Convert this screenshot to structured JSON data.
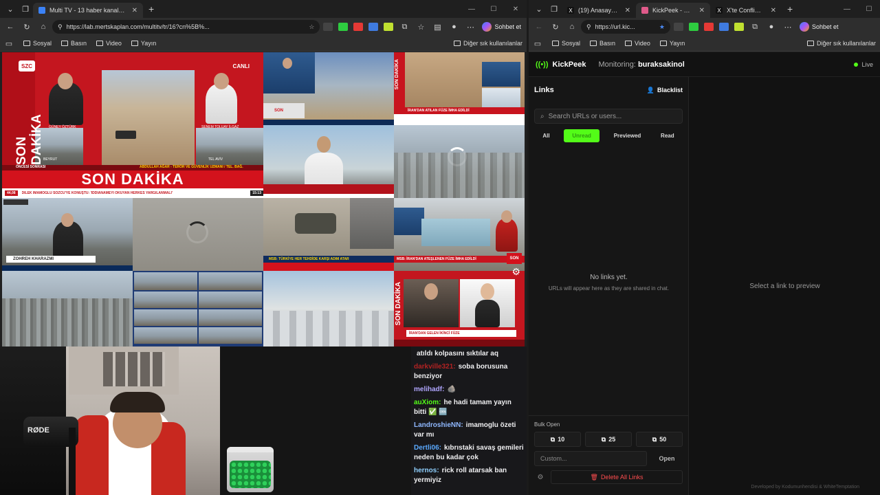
{
  "left_window": {
    "tabs": [
      {
        "title": "Multi TV - 13 haber kanalını aynı a..."
      }
    ],
    "address": "https://lab.mertskaplan.com/multitv/tr/16?cn%5B%...",
    "copilot_label": "Sohbet et",
    "bookmarks": [
      "Sosyal",
      "Basın",
      "Video",
      "Yayın"
    ],
    "other_bookmarks": "Diğer sık kullanılanlar"
  },
  "right_window": {
    "tabs": [
      {
        "title": "(19) Anasayfa / X"
      },
      {
        "title": "KickPeek - Real-tim"
      },
      {
        "title": "X'te Conflict: \"🔴 A"
      }
    ],
    "address": "https://url.kic...",
    "copilot_label": "Sohbet et",
    "bookmarks": [
      "Sosyal",
      "Basın",
      "Video",
      "Yayın"
    ],
    "other_bookmarks": "Diğer sık kullanılanlar"
  },
  "tv": {
    "szc_logo": "SZC",
    "canli": "CANLI",
    "son_dakika_big": "SON DAKİKA",
    "son_dakika_vertical": "SON DAKİKA",
    "ticker_main": "DİLEK İMAMOĞLU SÖZCÜ'YE KONUŞTU: 'İDDİANAMEYİ OKUYAN HERKES YARGILANMALI'",
    "ticker_left": "ÖNCESİ SONRASI",
    "ticker_guest": "ABDULLAH AĞAR - TERÖR VE GÜVENLİK UZMANI / TEL. BAĞ.",
    "temp": "44,08",
    "clock": "15:13",
    "loc_left": "BEYRUT",
    "loc_right": "TEL AVİV",
    "name_left": "GÜNEY ÖZTÜRK",
    "name_right": "SENEM TOLUAY İLGAZ",
    "aj_name": "ZOHREH KHARAZMI",
    "msb1": "MSB: TÜRKİYE HER TEHDİDE KARŞI ADIM ATAR",
    "msb2": "MSB: İRAN'DAN ATEŞLENEN FÜZE İMHA EDİLDİ",
    "iran_top": "İRAN'DAN ATILAN FÜZE İMHA EDİLDİ",
    "iran_bottom": "İRAN'DAN GELEN İKİNCİ FÜZE",
    "son_small": "SON"
  },
  "chat": {
    "messages": [
      {
        "user": "",
        "text": "atıldı kolpasını sıktılar aq",
        "color": "#efeff1"
      },
      {
        "user": "darkville321:",
        "text": "soba borusuna benziyor",
        "color": "#b22222"
      },
      {
        "user": "melihadf:",
        "text": "🪨",
        "color": "#b0a6ff"
      },
      {
        "user": "auXiom:",
        "text": "he hadi tamam yayın bitti ✅ 🆒",
        "color": "#53fc18"
      },
      {
        "user": "LandroshieNN:",
        "text": "imamoglu özeti var mı",
        "color": "#8fb8ff"
      },
      {
        "user": "Dertli06:",
        "text": "kıbrıstaki savaş gemileri neden bu kadar çok",
        "color": "#5aa9ff"
      },
      {
        "user": "hernos:",
        "text": "rick roll atarsak ban yermiyiz",
        "color": "#8fd0ff"
      }
    ]
  },
  "cam": {
    "mic_brand": "RØDE"
  },
  "kickpeek": {
    "brand": "KickPeek",
    "monitoring_label": "Monitoring:",
    "monitoring_user": "buraksakinol",
    "live": "Live",
    "links_title": "Links",
    "blacklist": "Blacklist",
    "search_placeholder": "Search URLs or users...",
    "filters": [
      "All",
      "Unread",
      "Previewed",
      "Read"
    ],
    "active_filter": "Unread",
    "empty_title": "No links yet.",
    "empty_sub": "URLs will appear here as they are shared in chat.",
    "preview_hint": "Select a link to preview",
    "bulk_label": "Bulk Open",
    "bulk_buttons": [
      "10",
      "25",
      "50"
    ],
    "custom_placeholder": "Custom...",
    "open": "Open",
    "delete_all": "Delete All Links",
    "credit": "Developed by Kodumunhendisi & WhiteTemptation",
    "accent": "#53fc18"
  }
}
